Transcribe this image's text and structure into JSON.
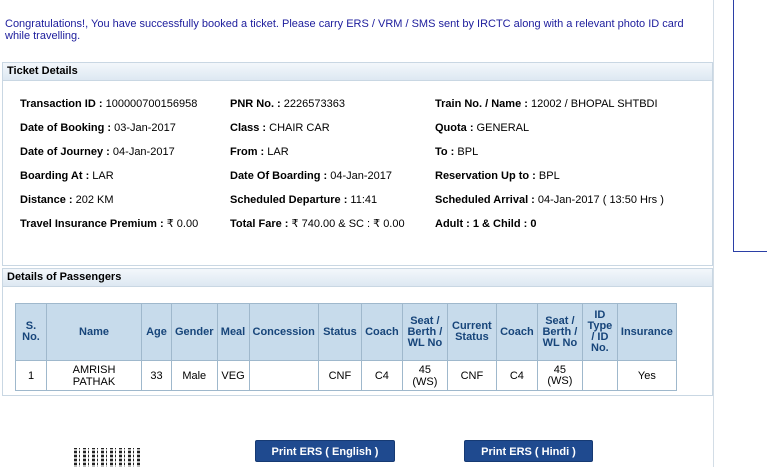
{
  "banner": "Congratulations!, You have successfully booked a ticket. Please carry ERS / VRM / SMS sent by IRCTC along with a relevant photo ID card while travelling.",
  "ticket_panel": {
    "title": "Ticket Details",
    "rows": [
      [
        {
          "label": "Transaction ID :",
          "value": " 100000700156958"
        },
        {
          "label": "PNR No. :",
          "value": " 2226573363"
        },
        {
          "label": "Train No. / Name :",
          "value": " 12002 / BHOPAL SHTBDI"
        }
      ],
      [
        {
          "label": "Date of Booking :",
          "value": " 03-Jan-2017"
        },
        {
          "label": "Class :",
          "value": " CHAIR CAR"
        },
        {
          "label": "Quota :",
          "value": " GENERAL"
        }
      ],
      [
        {
          "label": "Date of Journey :",
          "value": " 04-Jan-2017"
        },
        {
          "label": "From :",
          "value": " LAR"
        },
        {
          "label": "To :",
          "value": " BPL"
        }
      ],
      [
        {
          "label": "Boarding At :",
          "value": " LAR"
        },
        {
          "label": "Date Of Boarding :",
          "value": " 04-Jan-2017"
        },
        {
          "label": "Reservation Up to :",
          "value": " BPL"
        }
      ],
      [
        {
          "label": "Distance :",
          "value": " 202 KM"
        },
        {
          "label": "Scheduled Departure :",
          "value": " 11:41"
        },
        {
          "label": "Scheduled Arrival :",
          "value": " 04-Jan-2017 ( 13:50 Hrs )"
        }
      ],
      [
        {
          "label": "Travel Insurance Premium :",
          "value": " ₹ 0.00"
        },
        {
          "label": "Total Fare :",
          "value": " ₹ 740.00 & SC : ₹ 0.00"
        },
        {
          "label": "Adult : 1 & Child : 0",
          "value": ""
        }
      ]
    ]
  },
  "passenger_panel": {
    "title": "Details of Passengers",
    "headers": [
      "S. No.",
      "Name",
      "Age",
      "Gender",
      "Meal",
      "Concession",
      "Status",
      "Coach",
      "Seat / Berth / WL No",
      "Current Status",
      "Coach",
      "Seat / Berth / WL No",
      "ID Type / ID No.",
      "Insurance"
    ],
    "rows": [
      [
        "1",
        "AMRISH PATHAK",
        "33",
        "Male",
        "VEG",
        "",
        "CNF",
        "C4",
        "45 (WS)",
        "CNF",
        "C4",
        "45 (WS)",
        "",
        "Yes"
      ]
    ]
  },
  "buttons": {
    "print_english": "Print ERS ( English )",
    "print_hindi": "Print ERS ( Hindi )"
  },
  "icons": {
    "qr": "qr-code-icon"
  }
}
